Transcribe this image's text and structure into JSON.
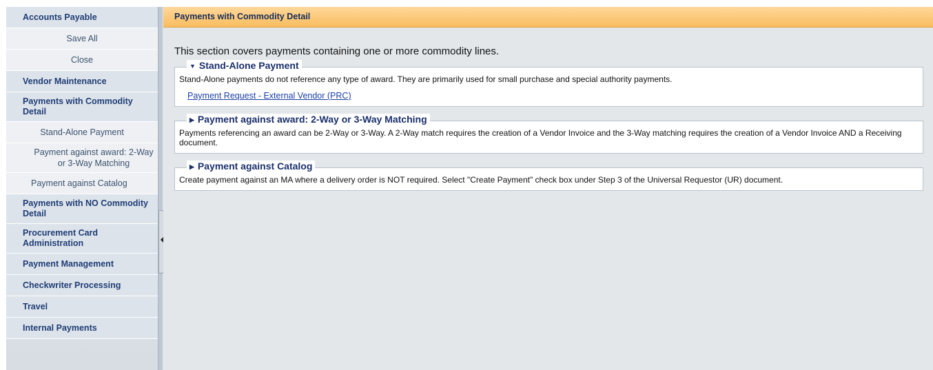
{
  "sidebar": {
    "items": [
      {
        "label": "Accounts Payable",
        "kind": "header"
      },
      {
        "label": "Save All",
        "kind": "sub"
      },
      {
        "label": "Close",
        "kind": "sub"
      },
      {
        "label": "Vendor Maintenance",
        "kind": "header"
      },
      {
        "label": "Payments with Commodity Detail",
        "kind": "header"
      },
      {
        "label": "Stand-Alone Payment",
        "kind": "sub"
      },
      {
        "label": "Payment against award: 2-Way or 3-Way Matching",
        "kind": "sub"
      },
      {
        "label": "Payment against Catalog",
        "kind": "sub"
      },
      {
        "label": "Payments with NO Commodity Detail",
        "kind": "header"
      },
      {
        "label": "Procurement Card Administration",
        "kind": "header"
      },
      {
        "label": "Payment Management",
        "kind": "header"
      },
      {
        "label": "Checkwriter Processing",
        "kind": "header"
      },
      {
        "label": "Travel",
        "kind": "header"
      },
      {
        "label": "Internal Payments",
        "kind": "header"
      }
    ]
  },
  "main": {
    "title": "Payments with Commodity Detail",
    "intro": "This section covers payments containing one or more commodity lines.",
    "sections": [
      {
        "title": "Stand-Alone Payment",
        "expanded": true,
        "text": "Stand-Alone payments do not reference any type of award. They are primarily used for small purchase and special authority payments.",
        "link": "Payment Request - External Vendor (PRC)"
      },
      {
        "title": "Payment against award: 2-Way or 3-Way Matching",
        "expanded": false,
        "text": "Payments referencing an award can be 2-Way or 3-Way. A 2-Way match requires the creation of a Vendor Invoice and the 3-Way matching requires the creation of a Vendor Invoice AND a Receiving document."
      },
      {
        "title": "Payment against Catalog",
        "expanded": false,
        "text": "Create payment against an MA where a delivery order is NOT required. Select \"Create Payment\" check box under Step 3 of the Universal Requestor (UR) document."
      }
    ]
  },
  "colors": {
    "title_bar": "#f8bd5f",
    "link": "#1a3fa6",
    "nav_text": "#1f3d75"
  }
}
